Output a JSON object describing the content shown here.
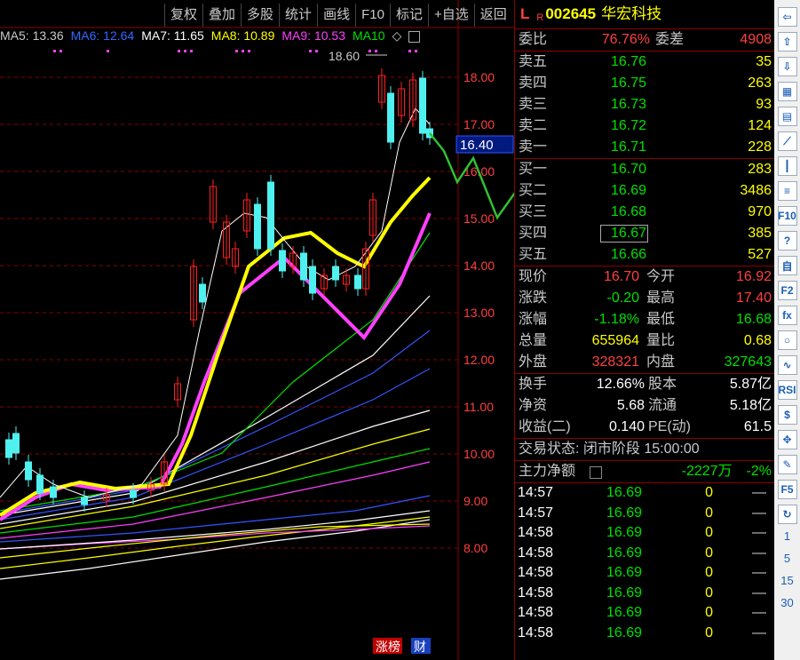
{
  "toolbar": [
    "复权",
    "叠加",
    "多股",
    "统计",
    "画线",
    "F10",
    "标记",
    "+自选",
    "返回"
  ],
  "ma": [
    {
      "label": "MA5: 13.36",
      "color": "#c8c8c8"
    },
    {
      "label": "MA6: 12.64",
      "color": "#2f6bff"
    },
    {
      "label": "MA7: 11.65",
      "color": "#ffffff"
    },
    {
      "label": "MA8: 10.89",
      "color": "#ffff00"
    },
    {
      "label": "MA9: 10.53",
      "color": "#ff40ff"
    },
    {
      "label": "MA10",
      "color": "#00e000"
    },
    {
      "label": "◇",
      "color": "#c8c8c8"
    }
  ],
  "price_axis": [
    "18.00",
    "17.00",
    "16.00",
    "15.00",
    "14.00",
    "13.00",
    "12.00",
    "11.00",
    "10.00",
    "9.00",
    "8.00"
  ],
  "price_axis_range": [
    8.0,
    18.0
  ],
  "high_marker": "18.60",
  "cursor_price": "16.40",
  "bottom_badges": {
    "zhangbang": "涨榜",
    "cai": "财"
  },
  "stock": {
    "flag_l": "L",
    "flag_r": "R",
    "code": "002645",
    "name": "华宏科技"
  },
  "ratio": {
    "wb_label": "委比",
    "wb_value": "76.76%",
    "wc_label": "委差",
    "wc_value": "4908"
  },
  "sell": [
    {
      "label": "卖五",
      "price": "16.76",
      "vol": "35"
    },
    {
      "label": "卖四",
      "price": "16.75",
      "vol": "263"
    },
    {
      "label": "卖三",
      "price": "16.73",
      "vol": "93"
    },
    {
      "label": "卖二",
      "price": "16.72",
      "vol": "124"
    },
    {
      "label": "卖一",
      "price": "16.71",
      "vol": "228"
    }
  ],
  "buy": [
    {
      "label": "买一",
      "price": "16.70",
      "vol": "283"
    },
    {
      "label": "买二",
      "price": "16.69",
      "vol": "3486"
    },
    {
      "label": "买三",
      "price": "16.68",
      "vol": "970"
    },
    {
      "label": "买四",
      "price": "16.67",
      "vol": "385"
    },
    {
      "label": "买五",
      "price": "16.66",
      "vol": "527"
    }
  ],
  "quote": [
    {
      "l1": "现价",
      "v1": "16.70",
      "c1": "#ff4040",
      "l2": "今开",
      "v2": "16.92",
      "c2": "#ff4040"
    },
    {
      "l1": "涨跌",
      "v1": "-0.20",
      "c1": "#00e000",
      "l2": "最高",
      "v2": "17.40",
      "c2": "#ff4040"
    },
    {
      "l1": "涨幅",
      "v1": "-1.18%",
      "c1": "#00e000",
      "l2": "最低",
      "v2": "16.68",
      "c2": "#00e000"
    },
    {
      "l1": "总量",
      "v1": "655964",
      "c1": "#ffff00",
      "l2": "量比",
      "v2": "0.68",
      "c2": "#ffff00"
    },
    {
      "l1": "外盘",
      "v1": "328321",
      "c1": "#ff4040",
      "l2": "内盘",
      "v2": "327643",
      "c2": "#00e000"
    }
  ],
  "fund": [
    {
      "l1": "换手",
      "v1": "12.66%",
      "l2": "股本",
      "v2": "5.87亿"
    },
    {
      "l1": "净资",
      "v1": "5.68",
      "l2": "流通",
      "v2": "5.18亿"
    },
    {
      "l1": "收益(二)",
      "v1": "0.140",
      "l2": "PE(动)",
      "v2": "61.5"
    }
  ],
  "trade_state": "交易状态: 闭市阶段 15:00:00",
  "main_flow": {
    "label": "主力净额",
    "value": "-2227万",
    "pct": "-2%"
  },
  "ticks": [
    {
      "time": "14:57",
      "price": "16.69",
      "vol": "0",
      "dir": "—"
    },
    {
      "time": "14:57",
      "price": "16.69",
      "vol": "0",
      "dir": "—"
    },
    {
      "time": "14:58",
      "price": "16.69",
      "vol": "0",
      "dir": "—"
    },
    {
      "time": "14:58",
      "price": "16.69",
      "vol": "0",
      "dir": "—"
    },
    {
      "time": "14:58",
      "price": "16.69",
      "vol": "0",
      "dir": "—"
    },
    {
      "time": "14:58",
      "price": "16.69",
      "vol": "0",
      "dir": "—"
    },
    {
      "time": "14:58",
      "price": "16.69",
      "vol": "0",
      "dir": "—"
    },
    {
      "time": "14:58",
      "price": "16.69",
      "vol": "0",
      "dir": "—"
    }
  ],
  "sidebar_icons": [
    "arrow-left-icon",
    "arrow-up-icon",
    "arrow-down-icon",
    "grid-icon",
    "table-icon",
    "line-chart-icon",
    "candle-icon",
    "list-icon",
    "f10-icon",
    "hint-icon",
    "self-icon",
    "f2-icon",
    "fx-icon",
    "circle-icon",
    "wave-icon",
    "rsi-icon",
    "dollar-icon",
    "move-icon",
    "pen-icon",
    "f5-icon",
    "refresh-icon"
  ],
  "sidebar_icon_text": {
    "f10-icon": "F10",
    "self-icon": "自",
    "f2-icon": "F2",
    "fx-icon": "fx",
    "rsi-icon": "RSI",
    "dollar-icon": "$",
    "f5-icon": "F5"
  },
  "sidebar_nums": [
    "1",
    "5",
    "15",
    "30"
  ],
  "colors": {
    "up": "#ff4040",
    "down": "#00e000",
    "grid": "#8b0000",
    "bg": "#000000",
    "cyan": "#4ff0f0"
  }
}
